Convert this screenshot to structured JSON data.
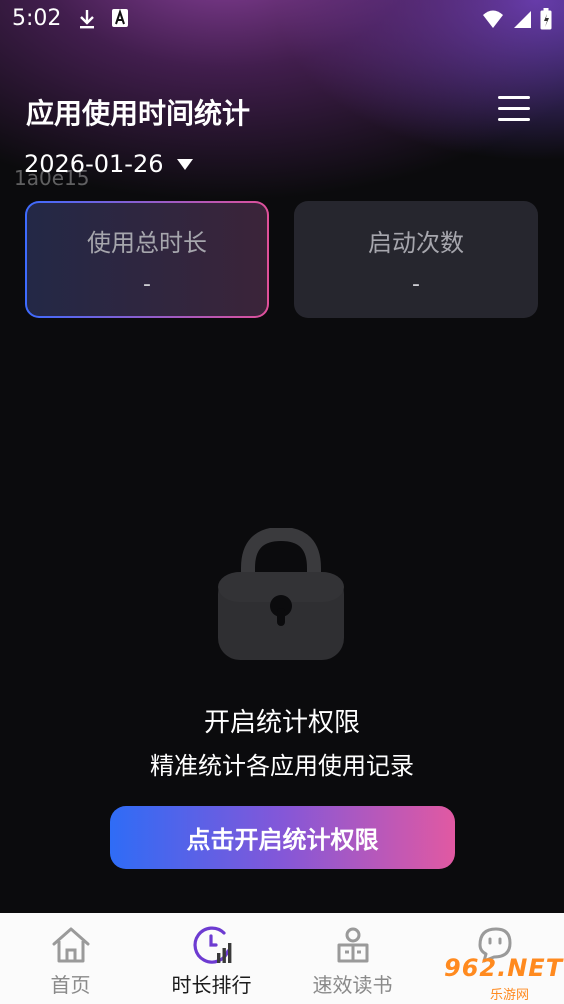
{
  "status_bar": {
    "time": "5:02"
  },
  "header": {
    "title": "应用使用时间统计"
  },
  "date_selector": {
    "value": "2026-01-26"
  },
  "overlay_id": "1a0e15",
  "cards": {
    "total": {
      "label": "使用总时长",
      "value": "-"
    },
    "launch": {
      "label": "启动次数",
      "value": "-"
    }
  },
  "permission": {
    "title": "开启统计权限",
    "subtitle": "精准统计各应用使用记录",
    "button_label": "点击开启统计权限"
  },
  "bottom_nav": {
    "items": [
      {
        "label": "首页",
        "icon": "home-icon",
        "active": false
      },
      {
        "label": "时长排行",
        "icon": "clock-chart-icon",
        "active": true
      },
      {
        "label": "速效读书",
        "icon": "book-reading-icon",
        "active": false
      },
      {
        "label": "",
        "icon": "chat-face-icon",
        "active": false
      }
    ]
  },
  "site_watermark": {
    "brand": "962.NET",
    "sub": "乐游网"
  },
  "colors": {
    "accent_blue": "#2f6cf6",
    "accent_pink": "#e159a2",
    "active_nav": "#6d3bd1",
    "background": "#0b0b0d"
  }
}
